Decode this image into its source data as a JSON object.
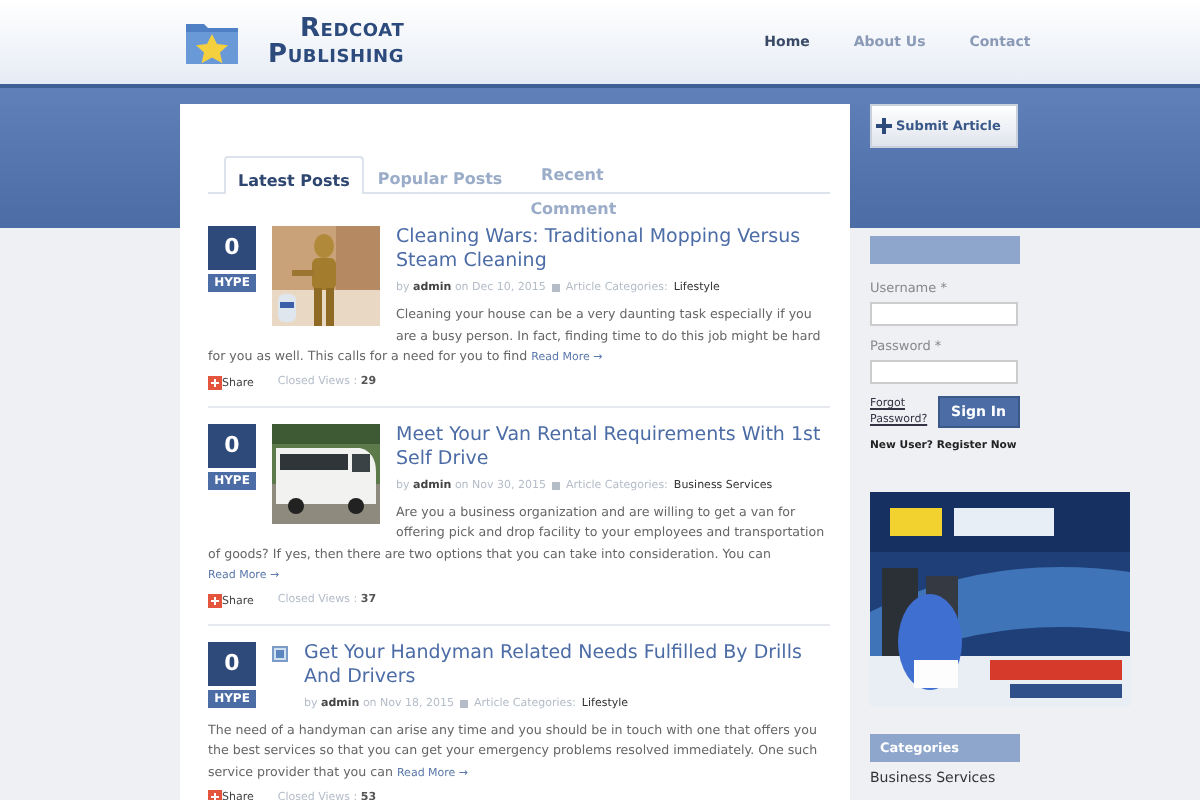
{
  "header": {
    "logo_line1": "Redcoat",
    "logo_line2": "Publishing",
    "nav": [
      {
        "label": "Home",
        "selected": true
      },
      {
        "label": "About Us",
        "selected": false
      },
      {
        "label": "Contact",
        "selected": false
      }
    ]
  },
  "submit_button": "Submit Article",
  "tabs": [
    {
      "label": "Latest Posts",
      "selected": true
    },
    {
      "label": "Popular Posts",
      "selected": false
    },
    {
      "label": "Recent Comment",
      "selected": false
    }
  ],
  "posts": [
    {
      "hype_count": "0",
      "hype_label": "HYPE",
      "title": "Cleaning Wars: Traditional Mopping Versus Steam Cleaning",
      "by": "by",
      "author": "admin",
      "on": "on Dec 10, 2015",
      "category_label": "Article Categories:",
      "category": "Lifestyle",
      "excerpt": "Cleaning your house can be a very daunting task especially if you are a busy person. In fact, finding time to do this job might be hard for you as well. This calls for a need for you to find",
      "read_more": "Read More →",
      "share": "Share",
      "views_label": "Closed Views :",
      "views": "29"
    },
    {
      "hype_count": "0",
      "hype_label": "HYPE",
      "title": "Meet Your Van Rental Requirements With 1st Self Drive",
      "by": "by",
      "author": "admin",
      "on": "on Nov 30, 2015",
      "category_label": "Article Categories:",
      "category": "Business Services",
      "excerpt": "Are you a business organization and are willing to get a van for offering pick and drop facility to your employees and transportation of goods? If yes, then there are two options that you can take into consideration. You can",
      "read_more": "Read More →",
      "share": "Share",
      "views_label": "Closed Views :",
      "views": "37"
    },
    {
      "hype_count": "0",
      "hype_label": "HYPE",
      "kind": "missing-image",
      "title": "Get Your Handyman Related Needs Fulfilled By Drills And Drivers",
      "by": "by",
      "author": "admin",
      "on": "on Nov 18, 2015",
      "category_label": "Article Categories:",
      "category": "Lifestyle",
      "excerpt": "The need of a handyman can arise any time and you should be in touch with one that offers you the best services so that you can get your emergency problems resolved immediately. One such service provider that you can",
      "read_more": "Read More →",
      "share": "Share",
      "views_label": "Closed Views :",
      "views": "53"
    }
  ],
  "login": {
    "username_label": "Username *",
    "password_label": "Password *",
    "forgot": "Forgot Password?",
    "sign_in": "Sign In",
    "register": "New User? Register Now"
  },
  "categories": {
    "title": "Categories",
    "items": [
      "Business Services"
    ]
  }
}
